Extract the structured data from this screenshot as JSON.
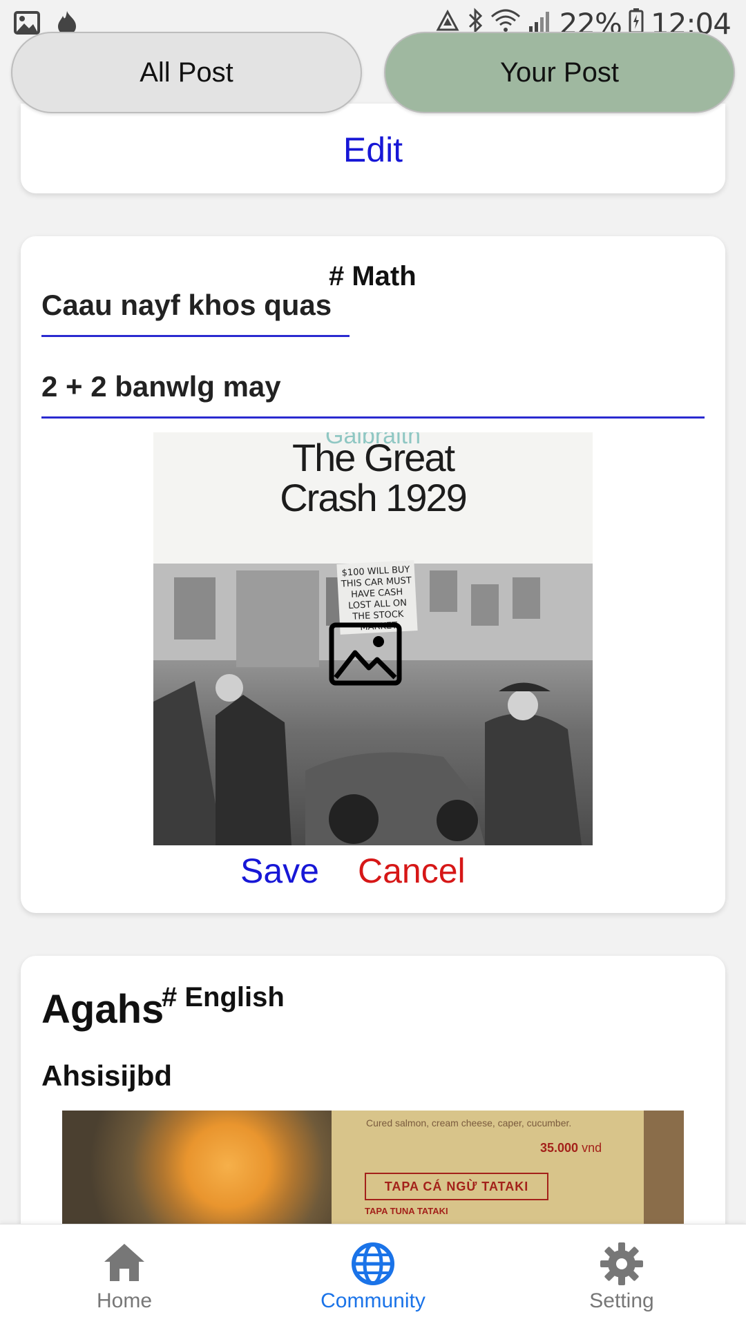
{
  "status_bar": {
    "battery": "22%",
    "time": "12:04"
  },
  "tabs": {
    "all_post": "All Post",
    "your_post": "Your Post"
  },
  "card1": {
    "edit_label": "Edit"
  },
  "card2": {
    "tag": "# Math",
    "title_value": "Caau nayf khos quas",
    "body_value": "2 + 2 banwlg may",
    "image": {
      "author": "Galbraith",
      "title_line1": "The Great",
      "title_line2": "Crash 1929",
      "sign_text": "$100 WILL BUY THIS CAR MUST HAVE CASH LOST ALL ON THE STOCK MARKET"
    },
    "save_label": "Save",
    "cancel_label": "Cancel"
  },
  "card3": {
    "title": "Agahs",
    "tag": "# English",
    "body": "Ahsisijbd",
    "image": {
      "description": "Cured salmon, cream cheese, caper, cucumber.",
      "price": "35.000",
      "price_unit": "vnd",
      "name": "TAPA CÁ NGỪ TATAKI",
      "subname": "TAPA TUNA TATAKI"
    }
  },
  "bottom_nav": {
    "home": "Home",
    "community": "Community",
    "setting": "Setting",
    "active": "community",
    "active_color": "#1a73e8"
  },
  "colors": {
    "link_blue": "#1717d6",
    "cancel_red": "#d61717",
    "your_post_bg": "#9fb8a0"
  }
}
